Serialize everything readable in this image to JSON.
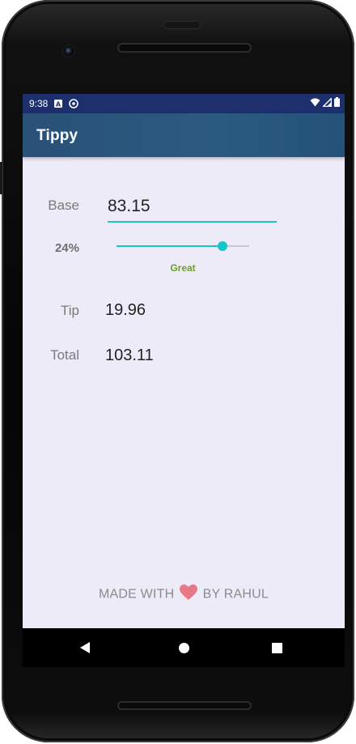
{
  "status_bar": {
    "time": "9:38",
    "notif_icons": [
      "a-box-icon",
      "at-sign-icon"
    ],
    "right_icons": [
      "wifi-icon",
      "signal-icon",
      "battery-icon"
    ],
    "background": "#1e2f6e"
  },
  "app_bar": {
    "title": "Tippy",
    "background": "#2a5178"
  },
  "form": {
    "base_label": "Base",
    "base_value": "83.15",
    "tip_percent_label": "24%",
    "tip_percent": 24,
    "slider_max": 30,
    "tip_description": "Great",
    "tip_description_color": "#6aa121",
    "tip_label": "Tip",
    "tip_amount": "19.96",
    "total_label": "Total",
    "total_amount": "103.11",
    "accent_color": "#17c5c8"
  },
  "footer": {
    "prefix": "MADE WITH",
    "suffix": "BY RAHUL",
    "heart_icon": "heart-icon",
    "heart_color": "#e57a86"
  },
  "nav_bar": {
    "buttons": [
      "back-icon",
      "home-icon",
      "recents-icon"
    ]
  }
}
